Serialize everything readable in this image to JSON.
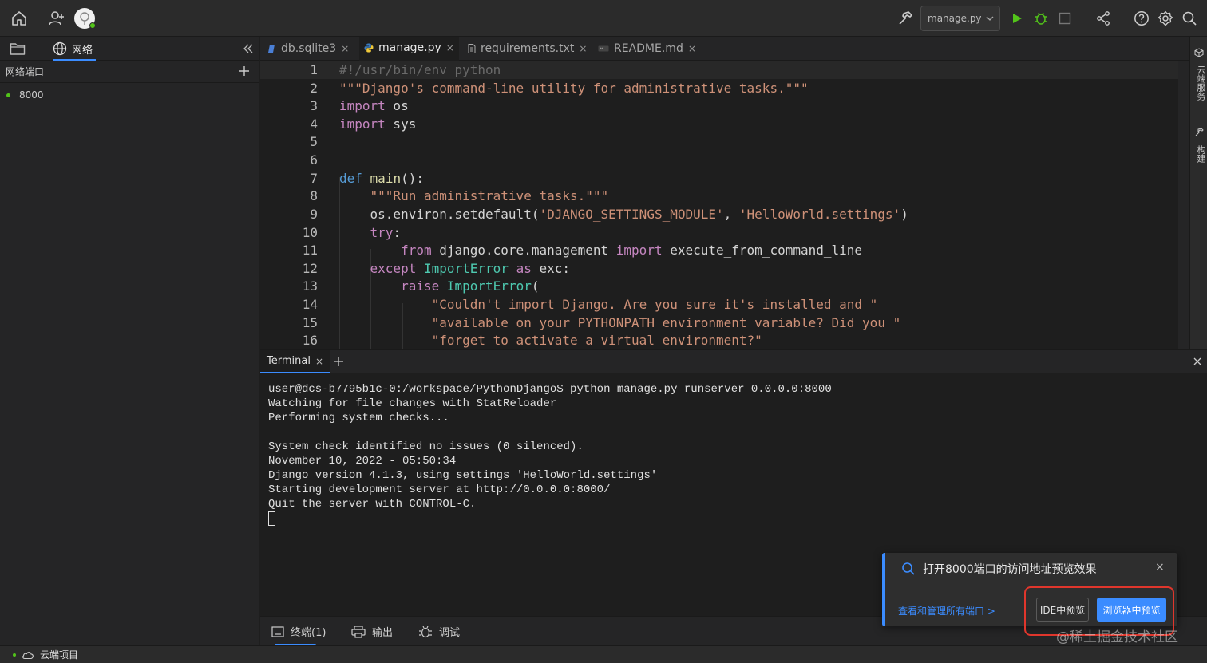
{
  "topbar": {
    "run_config": "manage.py",
    "icons": [
      "home-icon",
      "add-user-icon",
      "avatar",
      "hammer-icon",
      "run-icon",
      "debug-icon",
      "stop-icon",
      "share-icon",
      "help-icon",
      "gear-icon",
      "search-icon"
    ]
  },
  "sidebar": {
    "network_tab": "网络",
    "ports_header": "网络端口",
    "ports": [
      {
        "port": "8000"
      }
    ]
  },
  "editor": {
    "tabs": [
      {
        "label": "db.sqlite3"
      },
      {
        "label": "manage.py"
      },
      {
        "label": "requirements.txt"
      },
      {
        "label": "README.md"
      }
    ],
    "line_numbers": [
      "1",
      "2",
      "3",
      "4",
      "5",
      "6",
      "7",
      "8",
      "9",
      "10",
      "11",
      "12",
      "13",
      "14",
      "15",
      "16"
    ]
  },
  "right_rail": {
    "cloud_service": "云端服务",
    "build": "构建"
  },
  "terminal": {
    "tab_label": "Terminal",
    "lines": [
      "user@dcs-b7795b1c-0:/workspace/PythonDjango$ python manage.py runserver 0.0.0.0:8000",
      "Watching for file changes with StatReloader",
      "Performing system checks...",
      "",
      "System check identified no issues (0 silenced).",
      "November 10, 2022 - 05:50:34",
      "Django version 4.1.3, using settings 'HelloWorld.settings'",
      "Starting development server at http://0.0.0.0:8000/",
      "Quit the server with CONTROL-C."
    ]
  },
  "panel_tabs": {
    "terminal": "终端(1)",
    "output": "输出",
    "debug": "调试"
  },
  "statusbar": {
    "project": "云端项目"
  },
  "notice": {
    "message": "打开8000端口的访问地址预览效果",
    "link": "查看和管理所有端口 >",
    "ide_button": "IDE中预览",
    "browser_button": "浏览器中预览",
    "close": "×"
  },
  "watermark": "@稀土掘金技术社区",
  "colors": {
    "accent": "#3b8cff",
    "highlight_frame": "#e0362c",
    "status_green": "#52c41a"
  }
}
